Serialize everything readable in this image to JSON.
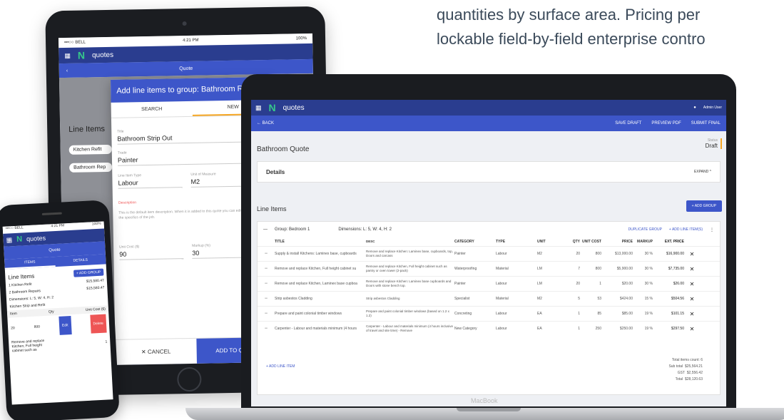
{
  "headline": {
    "line1": "quantities by surface area. Pricing per",
    "line2": "lockable field-by-field enterprise contro"
  },
  "colors": {
    "primary": "#2a3d8f",
    "accent": "#3d56c9",
    "highlight": "#f5a623",
    "logo_green": "#36c98a"
  },
  "tablet": {
    "status_carrier": "•••○○ BELL",
    "status_time": "4:21 PM",
    "status_battery": "100%",
    "app_name": "quotes",
    "sub_title": "Quote",
    "line_items_title": "Line Items",
    "rows": [
      "Kitchen Refit",
      "Bathroom Rep"
    ],
    "dimensions_note": "Dimensions: L: 5, H: 2, Kitchen Strip and Refit",
    "item_label": "Item",
    "footer_values": [
      "$1.34",
      "GST",
      "$3,115.11"
    ],
    "modal": {
      "title": "Add line items to group: Bathroom Repairs",
      "tab_search": "SEARCH",
      "tab_new": "NEW",
      "title_label": "Title",
      "title_value": "Bathroom Strip Out",
      "trade_label": "Trade",
      "trade_value": "Painter",
      "type_label": "Line Item Type",
      "type_value": "Labour",
      "uom_label": "Unit of Measure",
      "uom_value": "M2",
      "desc_label": "Description",
      "desc_value": "This is the default item description. When it is added to this quote you can edit it according to the specifics of the job.",
      "cost_label": "Unit Cost ($)",
      "cost_value": "90",
      "markup_label": "Markup (%)",
      "markup_value": "30",
      "cancel": "CANCEL",
      "add": "ADD TO QUOTE"
    }
  },
  "phone": {
    "status_carrier": "•••○○ BELL",
    "status_time": "4:21 PM",
    "status_battery": "100%",
    "app_name": "quotes",
    "sub_title": "Quote",
    "tab_items": "ITEMS",
    "tab_details": "DETAILS",
    "line_items_title": "Line Items",
    "add_group": "+ ADD GROUP",
    "groups": [
      {
        "num": "1",
        "name": "Kitchen Refit",
        "amount": "$15,580.47"
      },
      {
        "num": "2",
        "name": "Bathroom Repairs",
        "amount": "$15,580.47"
      }
    ],
    "dimensions": "Dimensions: L: 5, W: 4, H: 2",
    "group_desc": "Kitchen Strip and Refit",
    "col_item": "Item",
    "col_qty": "Qty",
    "col_cost": "Unit Cost ($)",
    "qty_value": "20",
    "cost_value": "800",
    "edit": "Edit",
    "delete": "Delete",
    "item2": "Remove and replace Kitchen, Full height cabinet such as",
    "item2_qty": "1"
  },
  "laptop": {
    "app_name": "quotes",
    "user": "Admin User",
    "back": "← BACK",
    "save_draft": "SAVE DRAFT",
    "preview_pdf": "PREVIEW PDF",
    "submit_final": "SUBMIT FINAL",
    "quote_title": "Bathroom Quote",
    "status_label": "Status",
    "status_value": "Draft",
    "details": "Details",
    "expand": "EXPAND",
    "line_items": "Line Items",
    "add_group": "+ ADD GROUP",
    "group_name": "Group: Bedroom 1",
    "group_dims": "Dimensions: L: 5, W: 4, H: 2",
    "duplicate_group": "DUPLICATE GROUP",
    "add_line_items": "+ ADD LINE ITEM(S)",
    "columns": [
      "TITLE",
      "DESC",
      "CATEGORY",
      "TYPE",
      "UNIT",
      "QTY",
      "UNIT COST",
      "PRICE",
      "MARKUP",
      "EXT. PRICE"
    ],
    "rows": [
      {
        "title": "Supply & install Kitchens: Laminex base, cupboards",
        "desc": "Remove and replace Kitchen: Laminex base, cupboards, top, Doors and carcass",
        "category": "Painter",
        "type": "Labour",
        "unit": "M2",
        "qty": "20",
        "cost": "800",
        "price": "$13,000.00",
        "markup": "30 %",
        "ext": "$16,900.00"
      },
      {
        "title": "Remove and replace Kitchen, Full height cabinet su",
        "desc": "Remove and replace Kitchen, Full height cabinet such as pantry or oven tower (2-pack)",
        "category": "Waterproofing",
        "type": "Material",
        "unit": "LM",
        "qty": "7",
        "cost": "800",
        "price": "$5,900.00",
        "markup": "30 %",
        "ext": "$7,735.00"
      },
      {
        "title": "Remove and replace Kitchen, Laminex base cupboa",
        "desc": "Remove and replace Kitchen: Laminex base cupboards and Doors with stone bench top.",
        "category": "Painter",
        "type": "Labour",
        "unit": "LM",
        "qty": "20",
        "cost": "1",
        "price": "$20.00",
        "markup": "30 %",
        "ext": "$26.00"
      },
      {
        "title": "Strip asbestos Cladding",
        "desc": "Strip asbestos Cladding",
        "category": "Specialist",
        "type": "Material",
        "unit": "M2",
        "qty": "5",
        "cost": "53",
        "price": "$424.00",
        "markup": "15 %",
        "ext": "$504.56"
      },
      {
        "title": "Prepare and paint colonial timber windows",
        "desc": "Prepare and paint colonial timber windows (based on 1.2 x 1.2)",
        "category": "Concreting",
        "type": "Labour",
        "unit": "EA",
        "qty": "1",
        "cost": "85",
        "price": "$85.00",
        "markup": "19 %",
        "ext": "$101.15"
      },
      {
        "title": "Carpenter - Labour and materials minimum (4 hours",
        "desc": "Carpenter - Labour and materials minimum (4 hours inclusive of travel and site time) - Remove",
        "category": "New Category",
        "type": "Labour",
        "unit": "EA",
        "qty": "1",
        "cost": "250",
        "price": "$250.00",
        "markup": "19 %",
        "ext": "$297.50"
      }
    ],
    "add_line_item": "+ ADD LINE ITEM",
    "total_count": "Total items count: 6",
    "sub_total_label": "Sub total",
    "sub_total": "$25,564.21",
    "gst_label": "GST",
    "gst": "$2,556.42",
    "total_label": "Total",
    "total": "$28,120.63",
    "brand": "MacBook"
  }
}
